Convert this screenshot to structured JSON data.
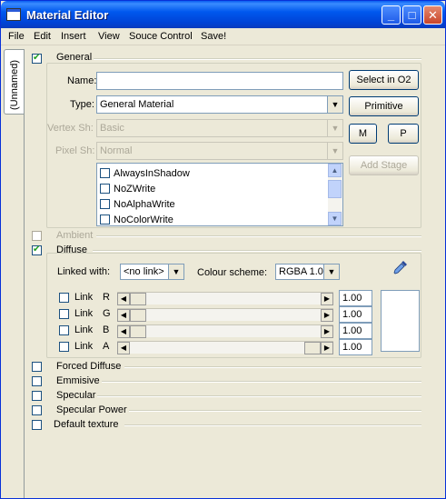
{
  "window": {
    "title": "Material Editor"
  },
  "titlebar_buttons": {
    "minimize": "_",
    "maximize": "□",
    "close": "✕"
  },
  "menu": [
    "File",
    "Edit",
    "Insert",
    "View",
    "Souce Control",
    "Save!"
  ],
  "side_tab": "(Unnamed)",
  "general": {
    "title": "General",
    "checked": true,
    "name_label": "Name:",
    "name_value": "",
    "type_label": "Type:",
    "type_value": "General Material",
    "vertex_label": "Vertex Sh:",
    "vertex_value": "Basic",
    "pixel_label": "Pixel Sh:",
    "pixel_value": "Normal",
    "flags": [
      "AlwaysInShadow",
      "NoZWrite",
      "NoAlphaWrite",
      "NoColorWrite"
    ],
    "select_button": "Select in O2",
    "primitive_button": "Primitive",
    "m_button": "M",
    "p_button": "P",
    "add_stage_button": "Add Stage"
  },
  "ambient": {
    "title": "Ambient",
    "checked": false
  },
  "diffuse": {
    "title": "Diffuse",
    "checked": true,
    "linked_label": "Linked with:",
    "linked_value": "<no link>",
    "scheme_label": "Colour scheme:",
    "scheme_value": "RGBA 1.0",
    "channels": [
      {
        "link": "Link",
        "channel": "R",
        "value": "1.00",
        "fraction": 0.0
      },
      {
        "link": "Link",
        "channel": "G",
        "value": "1.00",
        "fraction": 0.0
      },
      {
        "link": "Link",
        "channel": "B",
        "value": "1.00",
        "fraction": 0.0
      },
      {
        "link": "Link",
        "channel": "A",
        "value": "1.00",
        "fraction": 1.0
      }
    ],
    "swatch_color": "#ffffff"
  },
  "collapsed_sections": [
    "Forced Diffuse",
    "Emmisive",
    "Specular",
    "Specular Power",
    "Default texture"
  ],
  "arrows": {
    "left": "◀",
    "right": "▶",
    "down": "▼",
    "up": "▲"
  },
  "colors": {
    "title_bar": "#0058ee",
    "check_mark": "#21a121",
    "window_bg": "#ece9d8"
  }
}
